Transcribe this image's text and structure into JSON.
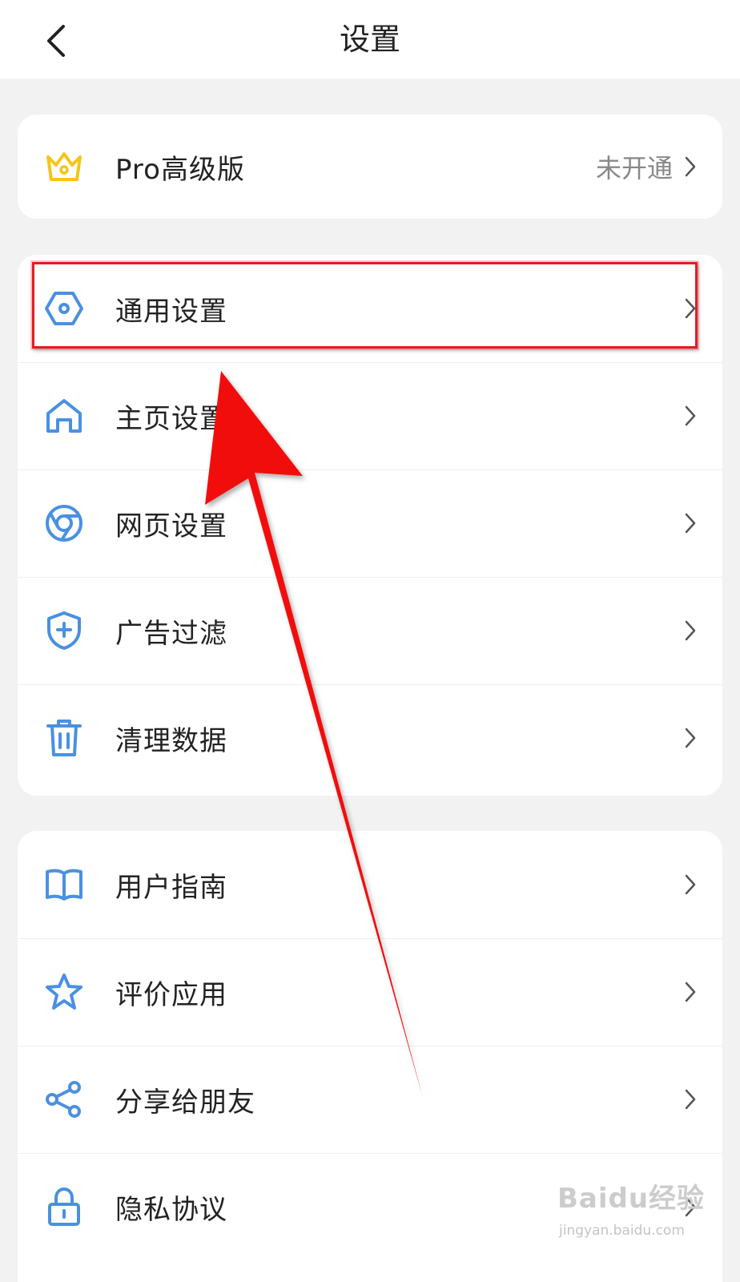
{
  "header": {
    "title": "设置",
    "back_icon": "chevron-left-icon"
  },
  "pro": {
    "icon": "crown-icon",
    "label": "Pro高级版",
    "value": "未开通",
    "icon_color": "#f5c518"
  },
  "settings_group": [
    {
      "id": "general",
      "icon": "hexagon-settings-icon",
      "label": "通用设置"
    },
    {
      "id": "home",
      "icon": "home-icon",
      "label": "主页设置"
    },
    {
      "id": "web",
      "icon": "browser-icon",
      "label": "网页设置"
    },
    {
      "id": "adblock",
      "icon": "shield-plus-icon",
      "label": "广告过滤"
    },
    {
      "id": "clear",
      "icon": "trash-icon",
      "label": "清理数据"
    }
  ],
  "info_group": [
    {
      "id": "guide",
      "icon": "book-icon",
      "label": "用户指南"
    },
    {
      "id": "rate",
      "icon": "star-icon",
      "label": "评价应用"
    },
    {
      "id": "share",
      "icon": "share-icon",
      "label": "分享给朋友"
    },
    {
      "id": "privacy",
      "icon": "lock-icon",
      "label": "隐私协议"
    }
  ],
  "colors": {
    "accent": "#4a90e2",
    "annotation": "#e51c23",
    "background": "#f2f2f2"
  },
  "watermark": {
    "brand": "Baidu经验",
    "url": "jingyan.baidu.com"
  }
}
